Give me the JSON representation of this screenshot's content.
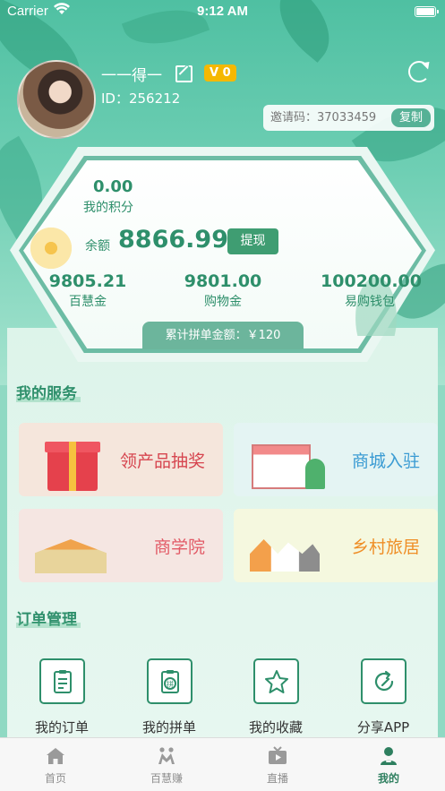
{
  "status_bar": {
    "carrier": "Carrier",
    "time": "9:12 AM"
  },
  "profile": {
    "nickname": "一一得一",
    "vip_level": "V 0",
    "user_id": "ID：256212",
    "invite_label": "邀请码：37033459",
    "copy_label": "复制"
  },
  "wallet": {
    "points_value": "0.00",
    "points_label": "我的积分",
    "balance_label": "余额",
    "balance_value": "8866.99",
    "withdraw_label": "提现",
    "stats": [
      {
        "value": "9805.21",
        "label": "百慧金"
      },
      {
        "value": "9801.00",
        "label": "购物金"
      },
      {
        "value": "100200.00",
        "label": "易购钱包"
      }
    ],
    "group_total_label": "累计拼单金额：￥120"
  },
  "services": {
    "title": "我的服务",
    "items": [
      {
        "label": "领产品抽奖",
        "color": "#d6454f",
        "bg": "#f5e6dc"
      },
      {
        "label": "商城入驻",
        "color": "#3a9bd3",
        "bg": "#e4f4f3"
      },
      {
        "label": "商学院",
        "color": "#e25a66",
        "bg": "#f5e6e2"
      },
      {
        "label": "乡村旅居",
        "color": "#ef8e26",
        "bg": "#f5f8df"
      }
    ]
  },
  "orders": {
    "title": "订单管理",
    "items": [
      {
        "label": "我的订单",
        "icon": "clipboard-icon"
      },
      {
        "label": "我的拼单",
        "icon": "group-order-icon"
      },
      {
        "label": "我的收藏",
        "icon": "star-icon"
      },
      {
        "label": "分享APP",
        "icon": "share-icon"
      }
    ]
  },
  "tab_bar": {
    "items": [
      {
        "label": "首页",
        "icon": "home-icon"
      },
      {
        "label": "百慧赚",
        "icon": "people-icon"
      },
      {
        "label": "直播",
        "icon": "tv-icon"
      },
      {
        "label": "我的",
        "icon": "person-icon"
      }
    ],
    "active_index": 3
  }
}
